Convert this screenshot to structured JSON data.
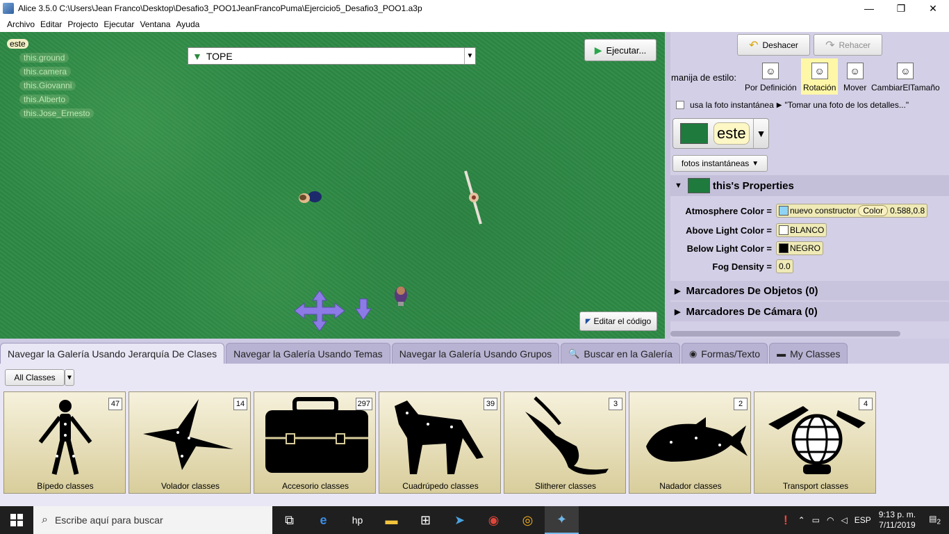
{
  "window": {
    "title": "Alice 3.5.0 C:\\Users\\Jean Franco\\Desktop\\Desafio3_POO1JeanFrancoPuma\\Ejercicio5_Desafio3_POO1.a3p",
    "minimize": "—",
    "maximize": "❐",
    "close": "✕"
  },
  "menu": [
    "Archivo",
    "Editar",
    "Projecto",
    "Ejecutar",
    "Ventana",
    "Ayuda"
  ],
  "scene": {
    "tree_root": "este",
    "tree_children": [
      "this.ground",
      "this.camera",
      "this.Giovanni",
      "this.Alberto",
      "this.Jose_Ernesto"
    ],
    "camera_marker": "TOPE",
    "run_label": "Ejecutar...",
    "edit_code_label": "Editar el código"
  },
  "right": {
    "undo": "Deshacer",
    "redo": "Rehacer",
    "style_label": "manija de estilo:",
    "handles": [
      {
        "label": "Por Definición",
        "icon": "default-handle-icon"
      },
      {
        "label": "Rotación",
        "icon": "rotation-handle-icon",
        "active": true
      },
      {
        "label": "Mover",
        "icon": "move-handle-icon"
      },
      {
        "label": "CambiarElTamaño",
        "icon": "resize-handle-icon"
      }
    ],
    "snapshot_checkbox": "usa la foto instantánea",
    "snapshot_hint": "\"Tomar una foto de los detalles...\"",
    "selected": "este",
    "snapshots_btn": "fotos instantáneas",
    "props_title": "this's Properties",
    "props": {
      "atmosphere_label": "Atmosphere Color =",
      "atmosphere_ctor": "nuevo constructor",
      "atmosphere_class": "Color",
      "atmosphere_v1": "0.588",
      "atmosphere_v2": ",",
      "atmosphere_v3": "0.8",
      "above_label": "Above Light Color =",
      "above_value": "BLANCO",
      "below_label": "Below Light Color =",
      "below_value": "NEGRO",
      "fog_label": "Fog Density =",
      "fog_value": "0.0"
    },
    "object_markers": "Marcadores De Objetos (0)",
    "camera_markers": "Marcadores De Cámara (0)"
  },
  "gallery": {
    "tabs": [
      "Navegar la Galería Usando Jerarquía De Clases",
      "Navegar la Galería Usando Temas",
      "Navegar la Galería Usando Grupos",
      "Buscar en la Galería",
      "Formas/Texto",
      "My Classes"
    ],
    "filter": "All Classes",
    "cards": [
      {
        "label": "Bípedo classes",
        "count": "47"
      },
      {
        "label": "Volador classes",
        "count": "14"
      },
      {
        "label": "Accesorio classes",
        "count": "297"
      },
      {
        "label": "Cuadrúpedo classes",
        "count": "39"
      },
      {
        "label": "Slitherer classes",
        "count": "3"
      },
      {
        "label": "Nadador classes",
        "count": "2"
      },
      {
        "label": "Transport classes",
        "count": "4"
      }
    ]
  },
  "taskbar": {
    "search_placeholder": "Escribe aquí para buscar",
    "lang": "ESP",
    "time": "9:13 p. m.",
    "date": "7/11/2019",
    "notifications": "2"
  }
}
